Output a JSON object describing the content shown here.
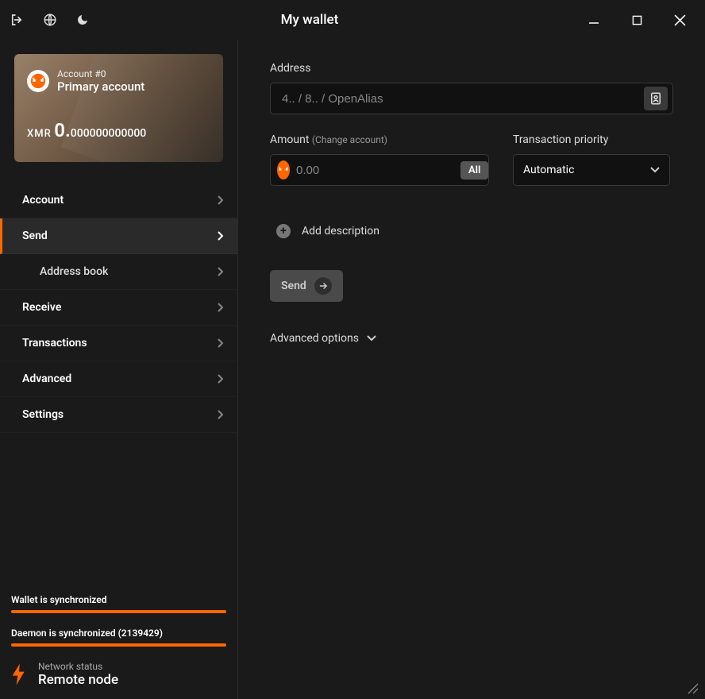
{
  "titlebar": {
    "title": "My wallet"
  },
  "account_card": {
    "account_label": "Account #0",
    "account_name": "Primary account",
    "currency": "XMR",
    "balance_int": "0.",
    "balance_dec": "000000000000"
  },
  "nav": {
    "account": "Account",
    "send": "Send",
    "address_book": "Address book",
    "receive": "Receive",
    "transactions": "Transactions",
    "advanced": "Advanced",
    "settings": "Settings"
  },
  "sync": {
    "wallet": "Wallet is synchronized",
    "daemon": "Daemon is synchronized (2139429)"
  },
  "network": {
    "label": "Network status",
    "value": "Remote node"
  },
  "send_form": {
    "address_label": "Address",
    "address_placeholder": "4.. / 8.. / OpenAlias",
    "amount_label": "Amount",
    "amount_hint": "(Change account)",
    "amount_placeholder": "0.00",
    "all_btn": "All",
    "priority_label": "Transaction priority",
    "priority_value": "Automatic",
    "add_description": "Add description",
    "send_btn": "Send",
    "advanced_options": "Advanced options"
  }
}
